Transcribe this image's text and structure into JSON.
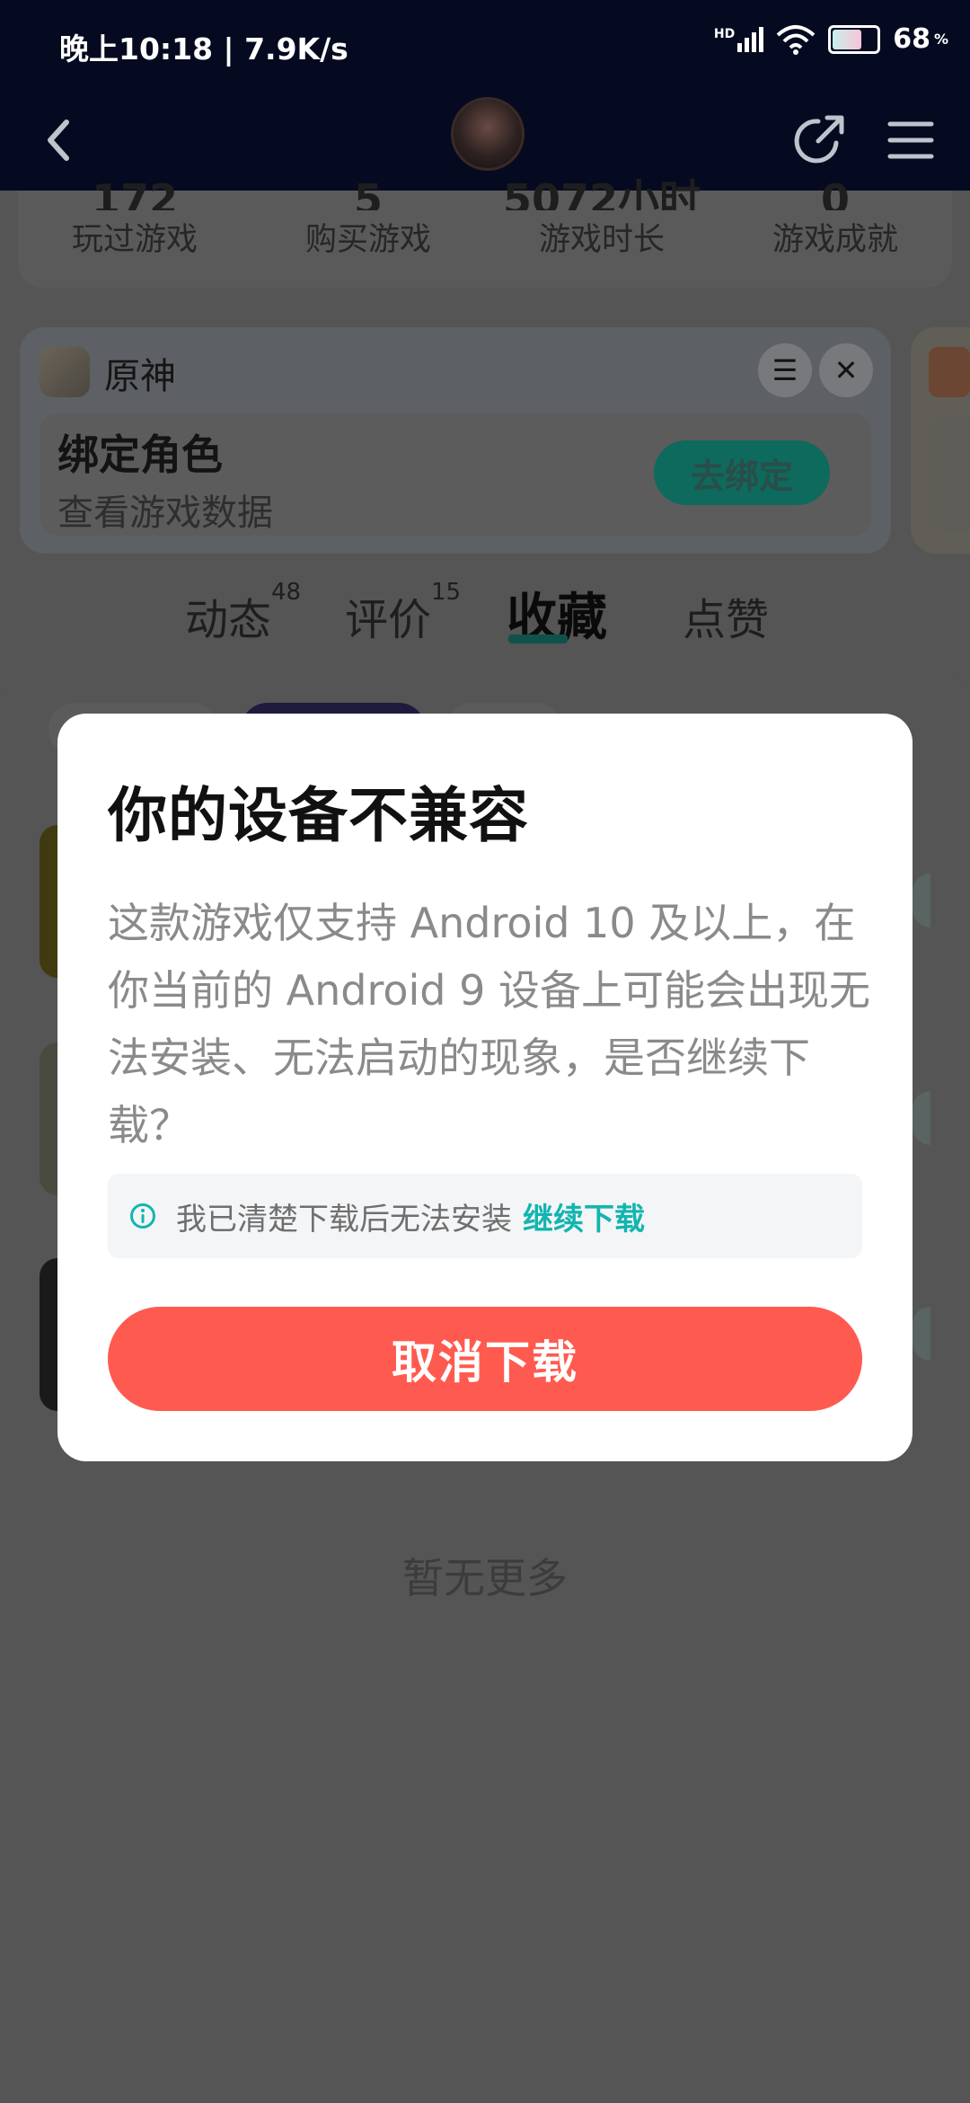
{
  "status_bar": {
    "time": "晚上10:18 | 7.9K/s",
    "signal_label": "HD",
    "battery": "68"
  },
  "header": {
    "back_icon": "chevron-left-icon",
    "share_icon": "share-icon",
    "menu_icon": "hamburger-menu-icon"
  },
  "stats": [
    {
      "value": "172",
      "label": "玩过游戏"
    },
    {
      "value": "5",
      "label": "购买游戏"
    },
    {
      "value": "5072小时",
      "label": "游戏时长"
    },
    {
      "value": "0",
      "label": "游戏成就"
    }
  ],
  "game_card": {
    "name": "原神",
    "bind_title": "绑定角色",
    "bind_subtitle": "查看游戏数据",
    "bind_button": "去绑定"
  },
  "tabs": [
    {
      "label": "动态",
      "count": "48"
    },
    {
      "label": "评价",
      "count": "15"
    },
    {
      "label": "收藏",
      "count": ""
    },
    {
      "label": "点赞",
      "count": ""
    }
  ],
  "active_tab": "收藏",
  "footer_text": "暂无更多",
  "dialog": {
    "title": "你的设备不兼容",
    "body": "这款游戏仅支持 Android 10 及以上，在你当前的 Android 9 设备上可能会出现无法安装、无法启动的现象，是否继续下载？",
    "confirm_text": "我已清楚下载后无法安装",
    "continue_link": "继续下载",
    "cancel_button": "取消下载"
  },
  "colors": {
    "header_bg": "#050a20",
    "accent_teal": "#13b5b0",
    "cancel_red": "#ff5a4f"
  }
}
